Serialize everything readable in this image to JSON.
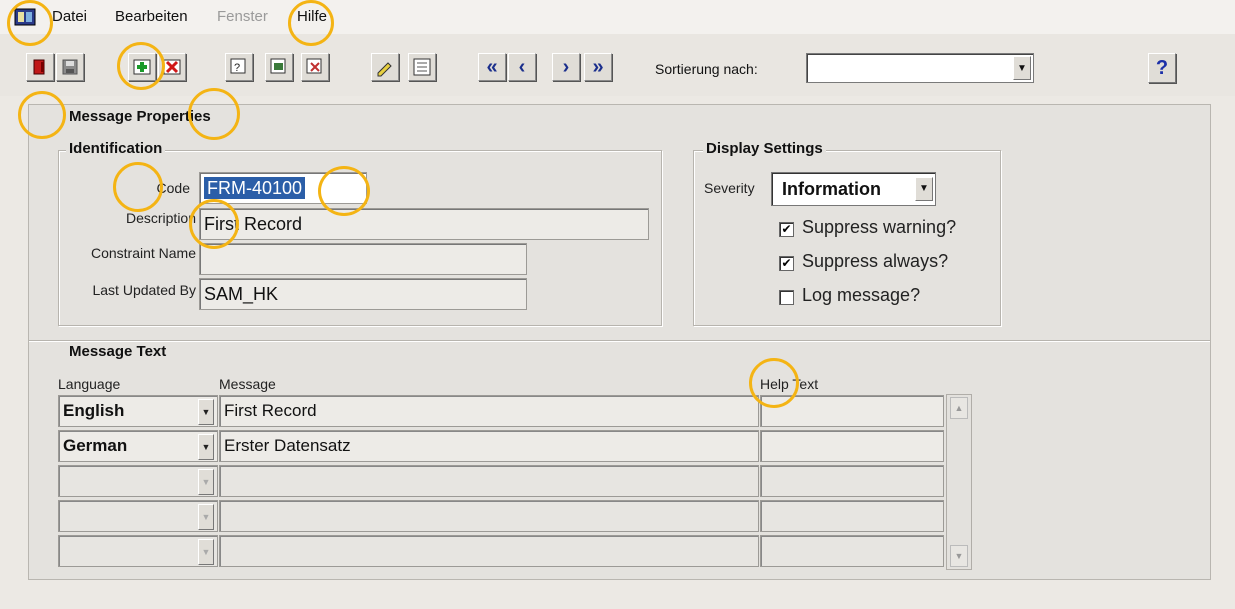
{
  "menu": {
    "items": [
      {
        "label": "Datei",
        "enabled": true
      },
      {
        "label": "Bearbeiten",
        "enabled": true
      },
      {
        "label": "Fenster",
        "enabled": false
      },
      {
        "label": "Hilfe",
        "enabled": true
      }
    ]
  },
  "toolbar": {
    "icons": [
      "exit-icon",
      "save-icon",
      "insert-record-icon",
      "delete-record-icon",
      "query-icon",
      "query-execute-icon",
      "clear-icon",
      "edit-icon",
      "list-icon",
      "first-record-icon",
      "previous-record-icon",
      "next-record-icon",
      "last-record-icon"
    ],
    "nav": {
      "first": "«",
      "prev": "‹",
      "next": "›",
      "last": "»"
    },
    "sort_label": "Sortierung nach:",
    "sort_value": "",
    "help": "?"
  },
  "form": {
    "title": "Message Properties",
    "identification": {
      "title": "Identification",
      "code_label": "Code",
      "code_value": "FRM-40100",
      "description_label": "Description",
      "description_value": "First Record",
      "constraint_label": "Constraint Name",
      "constraint_value": "",
      "updated_label": "Last Updated By",
      "updated_value": "SAM_HK"
    },
    "display": {
      "title": "Display Settings",
      "severity_label": "Severity",
      "severity_value": "Information",
      "options": [
        {
          "label": "Suppress warning?",
          "checked": true
        },
        {
          "label": "Suppress always?",
          "checked": true
        },
        {
          "label": "Log message?",
          "checked": false
        }
      ]
    },
    "message_text": {
      "title": "Message Text",
      "columns": {
        "language": "Language",
        "message": "Message",
        "help": "Help Text"
      },
      "rows": [
        {
          "language": "English",
          "message": "First Record",
          "help": ""
        },
        {
          "language": "German",
          "message": "Erster Datensatz",
          "help": ""
        },
        {
          "language": "",
          "message": "",
          "help": ""
        },
        {
          "language": "",
          "message": "",
          "help": ""
        },
        {
          "language": "",
          "message": "",
          "help": ""
        }
      ]
    }
  },
  "colors": {
    "highlight": "#f4b414",
    "selection": "#2b5ea8",
    "nav": "#1b2f8c"
  }
}
